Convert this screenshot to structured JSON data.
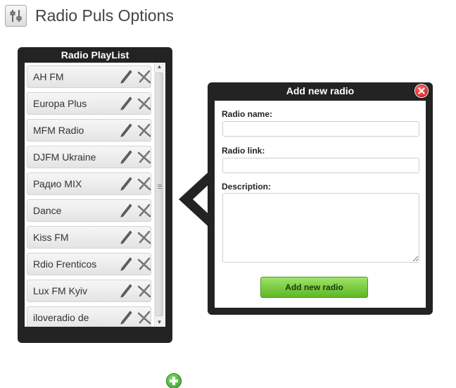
{
  "page": {
    "title": "Radio Puls Options",
    "icon": "settings-sliders-icon"
  },
  "playlist": {
    "title": "Radio PlayList",
    "items": [
      {
        "name": "AH FM"
      },
      {
        "name": "Europa Plus"
      },
      {
        "name": "MFM Radio"
      },
      {
        "name": "DJFM Ukraine"
      },
      {
        "name": "Радио MIX"
      },
      {
        "name": "Dance"
      },
      {
        "name": "Kiss FM"
      },
      {
        "name": "Rdio Frenticos"
      },
      {
        "name": "Lux FM Kyiv"
      },
      {
        "name": "iloveradio de"
      }
    ],
    "item_icons": {
      "edit": "pencil-icon",
      "delete": "cross-icon"
    },
    "add_icon": "plus-circle-icon"
  },
  "dialog": {
    "title": "Add new radio",
    "close_icon": "close-circle-icon",
    "name_label": "Radio name:",
    "name_value": "",
    "link_label": "Radio link:",
    "link_value": "",
    "description_label": "Description:",
    "description_value": "",
    "submit_label": "Add new radio"
  },
  "colors": {
    "panel_bg": "#232323",
    "button_green": "#5cb823",
    "close_red": "#cc1111",
    "add_green": "#2f9a1f"
  }
}
